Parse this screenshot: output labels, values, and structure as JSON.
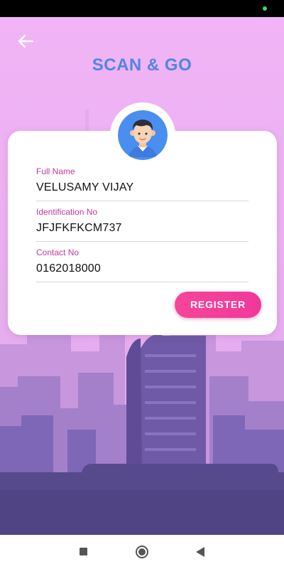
{
  "header": {
    "title": "SCAN & GO",
    "back_icon": "arrow-left-icon"
  },
  "profile": {
    "avatar_icon": "user-avatar-icon"
  },
  "form": {
    "full_name": {
      "label": "Full Name",
      "value": "VELUSAMY VIJAY"
    },
    "identification_no": {
      "label": "Identification No",
      "value": "JFJFKFKCM737"
    },
    "contact_no": {
      "label": "Contact No",
      "value": "0162018000"
    }
  },
  "actions": {
    "register_label": "REGISTER"
  },
  "navigation": {
    "recent_icon": "square-icon",
    "home_icon": "circle-icon",
    "back_icon": "triangle-back-icon"
  },
  "colors": {
    "title": "#4f86e6",
    "label": "#c0399a",
    "button": "#f1389a",
    "background_top": "#f1b4f6",
    "city_dark": "#574a8c"
  }
}
